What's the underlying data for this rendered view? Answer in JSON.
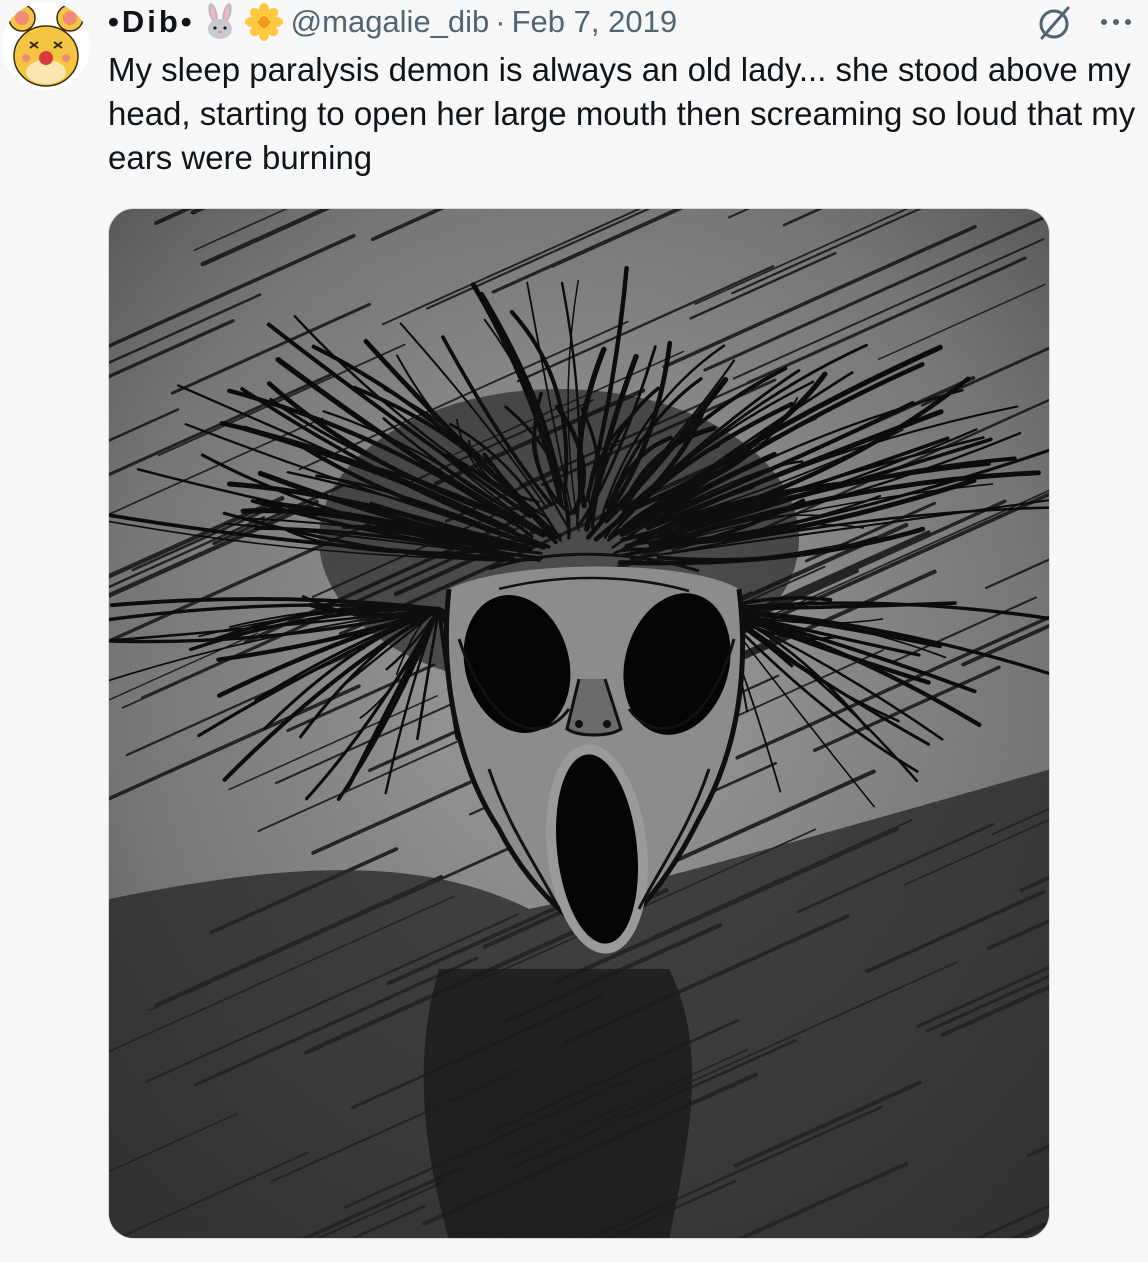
{
  "tweet": {
    "display_name": "•Dib•",
    "handle": "@magalie_dib",
    "separator": "·",
    "date": "Feb 7, 2019",
    "text": "My sleep paralysis demon is always an old lady... she stood above my head, starting to open her large mouth then screaming so loud that my ears were burning",
    "name_emojis": [
      "rabbit-emoji",
      "blossom-emoji"
    ]
  },
  "icons": {
    "grok": "grok-icon",
    "more": "more-icon"
  },
  "colors": {
    "text_primary": "#0f1419",
    "text_secondary": "#536471",
    "background": "#f7f7f7",
    "avatar_yellow": "#f4c542"
  }
}
